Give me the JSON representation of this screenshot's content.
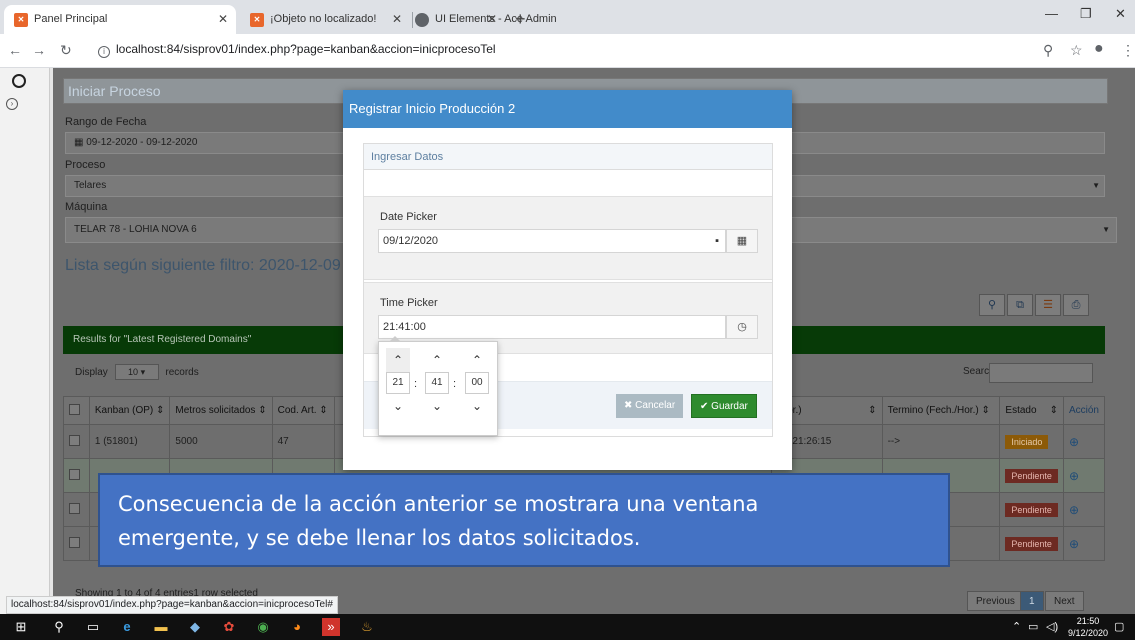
{
  "browser": {
    "tabs": [
      {
        "title": "Panel Principal",
        "favicon": "cross-logo-icon",
        "active": true
      },
      {
        "title": "¡Objeto no localizado!",
        "favicon": "cross-logo-icon",
        "active": false
      },
      {
        "title": "UI Elements - Ace Admin",
        "favicon": "globe-icon",
        "active": false
      }
    ],
    "url": "localhost:84/sisprov01/index.php?page=kanban&accion=inicprocesoTel",
    "status_url": "localhost:84/sisprov01/index.php?page=kanban&accion=inicprocesoTel#"
  },
  "page": {
    "header_title": "Iniciar Proceso",
    "rango_label": "Rango de Fecha",
    "rango_value": "09-12-2020 - 09-12-2020",
    "proceso_label": "Proceso",
    "proceso_value": "Telares",
    "maquina_label": "Máquina",
    "maquina_value": "TELAR 78 - LOHIA NOVA 6",
    "filter_title": "Lista según siguiente filtro: 2020-12-09",
    "results_title": "Results for \"Latest Registered Domains\"",
    "display_prefix": "Display",
    "display_count": "10",
    "display_suffix": "records",
    "search_label": "Search:",
    "columns": {
      "kanban": "Kanban (OP)",
      "metros": "Metros solicitados",
      "codart": "Cod. Art.",
      "inicio": "/Hor.)",
      "termino": "Termino (Fech./Hor.)",
      "estado": "Estado",
      "accion": "Acción"
    },
    "rows": [
      {
        "kanban": "1 (51801)",
        "metros": "5000",
        "codart": "47",
        "inicio": "--> 21:26:15",
        "termino": "-->",
        "estado": "Iniciado"
      },
      {
        "kanban": "",
        "metros": "",
        "codart": "",
        "inicio": "",
        "termino": "",
        "estado": "Pendiente"
      },
      {
        "kanban": "",
        "metros": "",
        "codart": "",
        "inicio": "",
        "termino": "",
        "estado": "Pendiente"
      },
      {
        "kanban": "",
        "metros": "",
        "codart": "",
        "inicio": "",
        "termino": "",
        "estado": "Pendiente"
      }
    ],
    "showing_text": "Showing 1 to 4 of 4 entries1 row selected",
    "pager": {
      "previous": "Previous",
      "current": "1",
      "next": "Next"
    }
  },
  "modal": {
    "title": "Registrar Inicio Producción 2",
    "section_title": "Ingresar Datos",
    "date_label": "Date Picker",
    "date_value": "09/12/2020",
    "time_label": "Time Picker",
    "time_value": "21:41:00",
    "cancel_label": "Cancelar",
    "save_label": "Guardar"
  },
  "timepicker": {
    "hour": "21",
    "minute": "41",
    "second": "00"
  },
  "callout": {
    "line1": "Consecuencia de la acción anterior se mostrara una ventana",
    "line2": "emergente, y se debe llenar los datos solicitados."
  },
  "taskbar": {
    "time": "21:50",
    "date": "9/12/2020"
  },
  "colors": {
    "modal_header": "#428bca",
    "save_button": "#2e8b2e",
    "callout": "#4472c4",
    "results_header": "#073a07"
  }
}
